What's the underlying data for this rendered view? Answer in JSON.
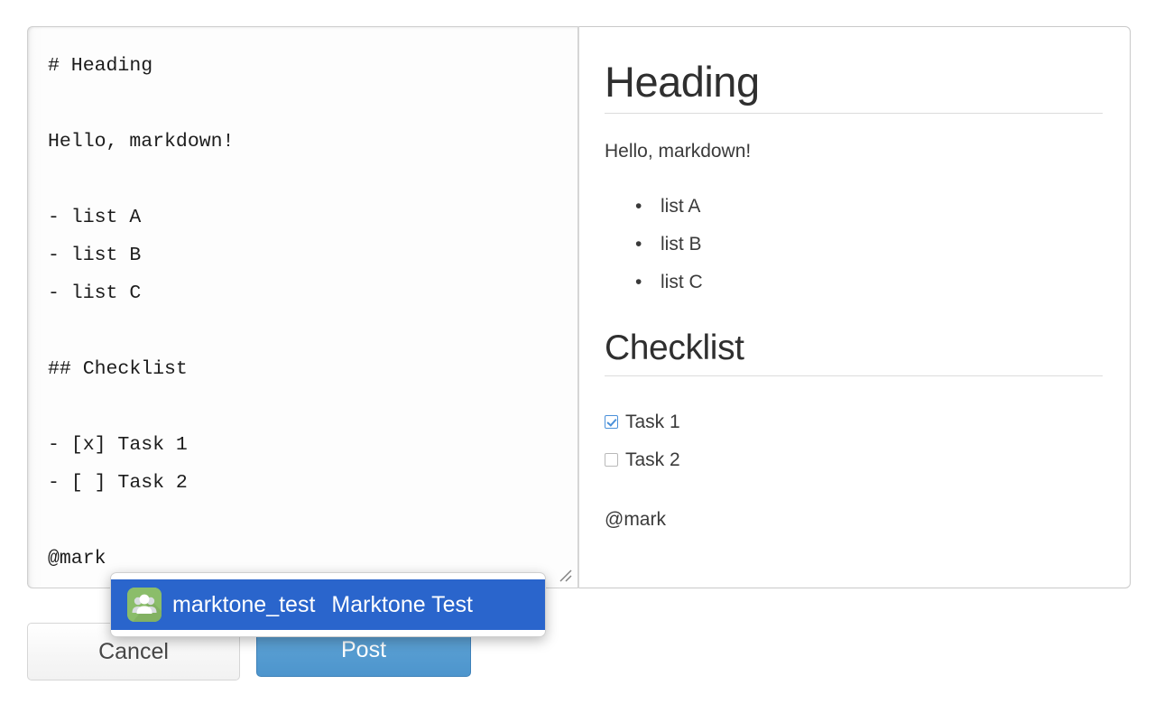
{
  "editor": {
    "name": "markdown-source-textarea",
    "content": "# Heading\n\nHello, markdown!\n\n- list A\n- list B\n- list C\n\n## Checklist\n\n- [x] Task 1\n- [ ] Task 2\n\n@mark",
    "placeholder": "",
    "resize_handle_icon": "resize-grip-icon"
  },
  "preview": {
    "h1": "Heading",
    "paragraph": "Hello, markdown!",
    "bullets": [
      "list A",
      "list B",
      "list C"
    ],
    "h2": "Checklist",
    "tasks": [
      {
        "label": "Task 1",
        "checked": true
      },
      {
        "label": "Task 2",
        "checked": false
      }
    ],
    "mention_text": "@mark"
  },
  "actions": {
    "cancel_label": "Cancel",
    "post_label": "Post"
  },
  "autocomplete": {
    "query": "@mark",
    "items": [
      {
        "code": "marktone_test",
        "display_name": "Marktone Test",
        "avatar_icon": "group-avatar-icon",
        "selected": true
      }
    ]
  },
  "colors": {
    "highlight_blue": "#2a65cc",
    "post_button_blue": "#4d95cd",
    "avatar_green": "#8bbd6a",
    "checkbox_checked_blue": "#4a90d9",
    "border_grey": "#c9c9c9",
    "text_dark": "#333333"
  }
}
